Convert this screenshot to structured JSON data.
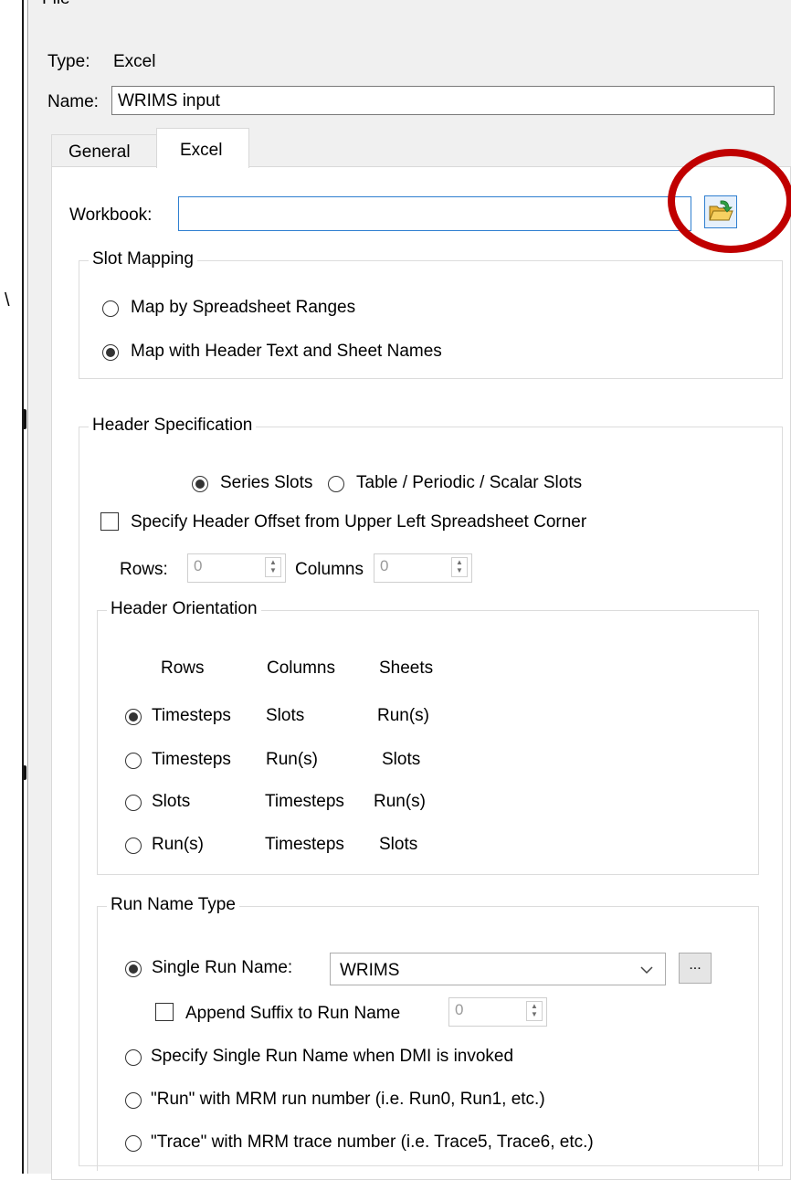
{
  "menu": {
    "file_label": "File"
  },
  "stray_mark": "\\",
  "dialog": {
    "type_label": "Type:",
    "type_value": "Excel",
    "name_label": "Name:",
    "name_value": "WRIMS input",
    "tabs": [
      {
        "label": "General"
      },
      {
        "label": "Excel"
      }
    ],
    "active_tab": "Excel"
  },
  "excel": {
    "workbook_label": "Workbook:",
    "workbook_value": "",
    "browse_icon": "folder-open-arrow-icon",
    "highlight_color": "#c00000",
    "slot_mapping": {
      "title": "Slot Mapping",
      "options": [
        {
          "label": "Map by Spreadsheet Ranges",
          "selected": false
        },
        {
          "label": "Map with Header Text and Sheet Names",
          "selected": true
        }
      ]
    },
    "header_spec": {
      "title": "Header Specification",
      "slot_types": [
        {
          "label": "Series Slots",
          "selected": true
        },
        {
          "label": "Table / Periodic / Scalar Slots",
          "selected": false
        }
      ],
      "offset_label": "Specify Header Offset from Upper Left Spreadsheet Corner",
      "offset_checked": false,
      "rows_label": "Rows:",
      "rows_value": "0",
      "columns_label": "Columns",
      "columns_value": "0",
      "orientation": {
        "title": "Header Orientation",
        "headers": [
          "Rows",
          "Columns",
          "Sheets"
        ],
        "options": [
          {
            "rows": "Timesteps",
            "columns": "Slots",
            "sheets": "Run(s)",
            "selected": true
          },
          {
            "rows": "Timesteps",
            "columns": "Run(s)",
            "sheets": "Slots",
            "selected": false
          },
          {
            "rows": "Slots",
            "columns": "Timesteps",
            "sheets": "Run(s)",
            "selected": false
          },
          {
            "rows": "Run(s)",
            "columns": "Timesteps",
            "sheets": "Slots",
            "selected": false
          }
        ]
      }
    },
    "run_name": {
      "title": "Run Name Type",
      "single_label": "Single Run Name:",
      "single_selected": true,
      "single_value": "WRIMS",
      "more_label": "...",
      "suffix_label": "Append Suffix to Run Name",
      "suffix_checked": false,
      "suffix_value": "0",
      "options": [
        {
          "label": "Specify Single Run Name when DMI is invoked",
          "selected": false
        },
        {
          "label": "\"Run\" with MRM run number (i.e. Run0, Run1, etc.)",
          "selected": false
        },
        {
          "label": "\"Trace\" with MRM trace number (i.e. Trace5, Trace6, etc.)",
          "selected": false
        }
      ]
    }
  }
}
